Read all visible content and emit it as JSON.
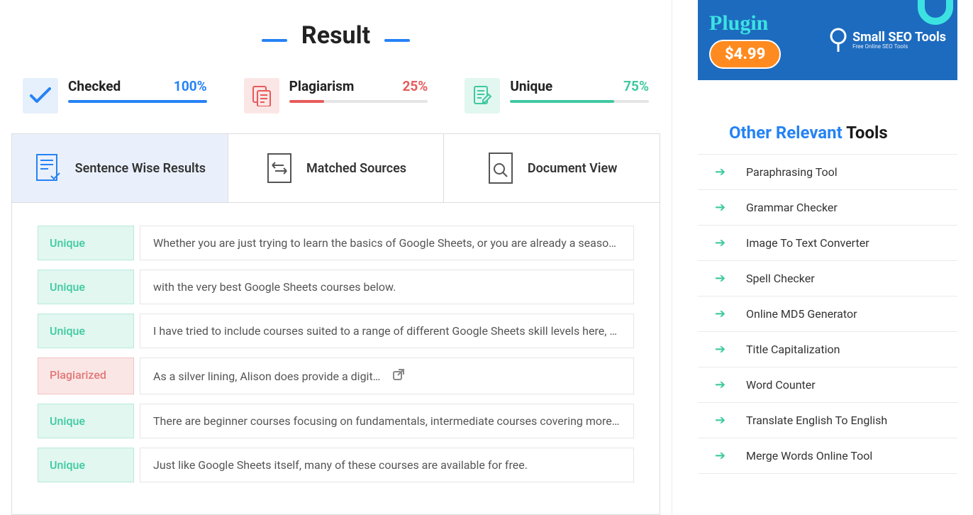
{
  "result": {
    "title": "Result",
    "stats": {
      "checked": {
        "label": "Checked",
        "value": "100%"
      },
      "plagiarism": {
        "label": "Plagiarism",
        "value": "25%"
      },
      "unique": {
        "label": "Unique",
        "value": "75%"
      }
    }
  },
  "tabs": {
    "sentence": "Sentence Wise Results",
    "matched": "Matched Sources",
    "document": "Document View"
  },
  "rows": [
    {
      "tag": "Unique",
      "type": "unique",
      "text": "Whether you are just trying to learn the basics of Google Sheets, or you are already a seasoned s…"
    },
    {
      "tag": "Unique",
      "type": "unique",
      "text": "with the very best Google Sheets courses below."
    },
    {
      "tag": "Unique",
      "type": "unique",
      "text": "I have tried to include courses suited to a range of different Google Sheets skill levels here, so you …"
    },
    {
      "tag": "Plagiarized",
      "type": "plagiarized",
      "text": "As a silver lining, Alison does provide a digital certification of completion (for some cours…",
      "hasLink": true
    },
    {
      "tag": "Unique",
      "type": "unique",
      "text": "There are beginner courses focusing on fundamentals, intermediate courses covering more adv…"
    },
    {
      "tag": "Unique",
      "type": "unique",
      "text": "Just like Google Sheets itself, many of these courses are available for free."
    }
  ],
  "ad": {
    "word": "Plugin",
    "price": "$4.99",
    "logo_main": "Small SEO Tools",
    "logo_sub": "Free Online SEO Tools"
  },
  "tools": {
    "heading_blue": "Other Relevant",
    "heading_dark": "Tools",
    "items": [
      "Paraphrasing Tool",
      "Grammar Checker",
      "Image To Text Converter",
      "Spell Checker",
      "Online MD5 Generator",
      "Title Capitalization",
      "Word Counter",
      "Translate English To English",
      "Merge Words Online Tool"
    ]
  }
}
